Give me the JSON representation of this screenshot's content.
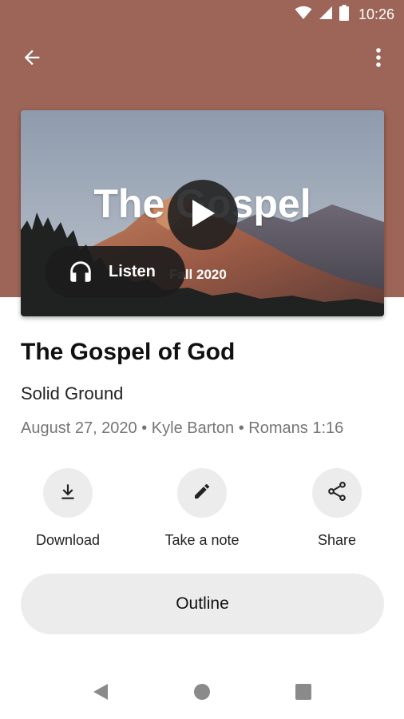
{
  "colors": {
    "header_background": "#9c6558",
    "action_circle": "#ececec",
    "meta_text": "#757575"
  },
  "status_bar": {
    "time": "10:26",
    "icons": [
      "wifi-icon",
      "signal-icon",
      "battery-icon"
    ]
  },
  "app_bar": {
    "back_icon": "arrow-left-icon",
    "menu_icon": "more-vertical-icon"
  },
  "artwork": {
    "title": "The Gospel",
    "subtitle": "Fall 2020",
    "play_icon": "play-icon",
    "listen_label": "Listen",
    "listen_icon": "headphones-icon"
  },
  "sermon": {
    "title": "The Gospel of God",
    "series": "Solid Ground",
    "meta": "August 27, 2020 • Kyle Barton • Romans 1:16"
  },
  "actions": [
    {
      "label": "Download",
      "icon": "download-icon"
    },
    {
      "label": "Take a note",
      "icon": "pencil-icon"
    },
    {
      "label": "Share",
      "icon": "share-icon"
    }
  ],
  "outline": {
    "label": "Outline"
  },
  "nav_bar": {
    "icons": [
      "back-triangle-icon",
      "home-circle-icon",
      "recents-square-icon"
    ]
  }
}
